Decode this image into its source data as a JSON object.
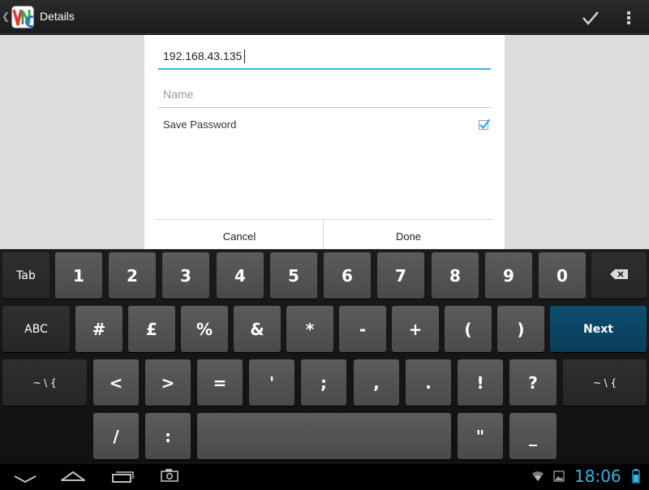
{
  "actionbar": {
    "title": "Details",
    "logo_icon": "vnc-logo-icon",
    "actions": [
      "check-icon",
      "overflow-menu-icon"
    ]
  },
  "form": {
    "address_value": "192.168.43.135",
    "name_placeholder": "Name",
    "name_value": "",
    "save_password_label": "Save Password",
    "save_password_checked": true,
    "cancel_label": "Cancel",
    "done_label": "Done"
  },
  "keyboard": {
    "row1": [
      "Tab",
      "1",
      "2",
      "3",
      "4",
      "5",
      "6",
      "7",
      "8",
      "9",
      "0"
    ],
    "row2": [
      "ABC",
      "#",
      "£",
      "%",
      "&",
      "*",
      "-",
      "+",
      "(",
      ")",
      "Next"
    ],
    "row3": [
      "~ \\ {",
      "<",
      ">",
      "=",
      "'",
      ";",
      ",",
      ".",
      "!",
      "?",
      "~ \\ {"
    ],
    "row4": [
      "/",
      ":",
      "\"",
      "_"
    ],
    "backspace_icon": "backspace-icon",
    "space_label": ""
  },
  "sysbar": {
    "time": "18:06",
    "nav_icons": [
      "back-icon",
      "home-icon",
      "recent-apps-icon",
      "screenshot-icon"
    ],
    "status_icons": [
      "wifi-icon",
      "image-notification-icon",
      "battery-icon"
    ]
  },
  "colors": {
    "accent": "#33b5e5",
    "next_key": "#0b4f6f"
  }
}
